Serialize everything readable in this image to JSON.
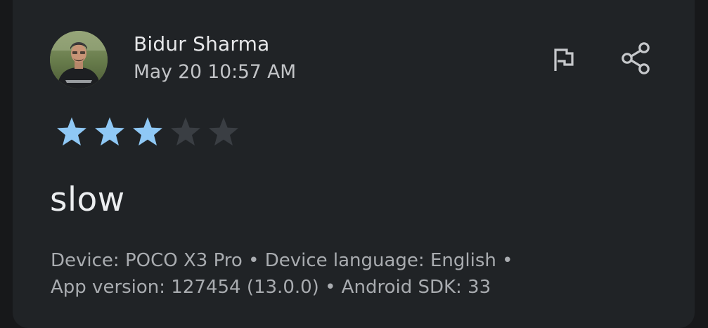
{
  "review": {
    "author": "Bidur Sharma",
    "date": "May 20 10:57 AM",
    "rating": 3,
    "rating_max": 5,
    "text": "slow",
    "device_line": "Device: POCO X3 Pro • Device language: English •",
    "app_line": "App version: 127454 (13.0.0) • Android SDK: 33"
  },
  "icons": {
    "flag": "flag-icon",
    "share": "share-icon"
  },
  "colors": {
    "background": "#202326",
    "star_filled": "#8fc8f5",
    "star_empty": "#3a3e43",
    "text_primary": "#e6e7e9",
    "text_secondary": "#a9acb0"
  }
}
